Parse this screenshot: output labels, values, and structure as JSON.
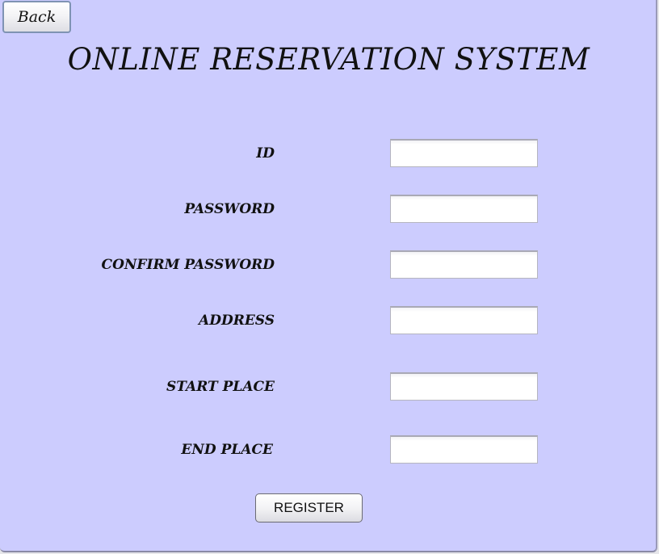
{
  "back_button": {
    "label": "Back"
  },
  "title": "ONLINE RESERVATION SYSTEM",
  "form": {
    "fields": [
      {
        "label": "ID",
        "value": ""
      },
      {
        "label": "PASSWORD",
        "value": ""
      },
      {
        "label": "CONFIRM PASSWORD",
        "value": ""
      },
      {
        "label": "ADDRESS",
        "value": ""
      },
      {
        "label": "START PLACE",
        "value": ""
      },
      {
        "label": "END PLACE",
        "value": ""
      }
    ]
  },
  "register_button": {
    "label": "REGISTER"
  },
  "colors": {
    "background": "#ccccfe",
    "field_background": "#ffffff"
  }
}
